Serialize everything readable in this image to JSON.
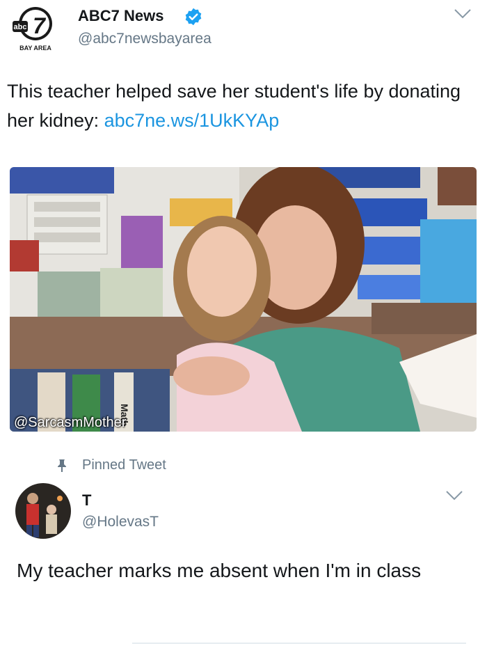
{
  "tweet1": {
    "display_name": "ABC7 News",
    "handle": "@abc7newsbayarea",
    "logo_text": "abc",
    "logo_number": "7",
    "logo_caption": "BAY AREA",
    "text": "This teacher helped save her student's life by donating her kidney: ",
    "link": "abc7ne.ws/1UkKYAp",
    "media_watermark": "@SarcasmMother",
    "media_book_label": "Math"
  },
  "pinned": {
    "label": "Pinned Tweet"
  },
  "tweet2": {
    "display_name": "T",
    "handle": "@HolevasT",
    "text": "My teacher marks me absent when I'm in class"
  },
  "colors": {
    "link": "#1b95e0",
    "secondary_text": "#657786",
    "verified": "#1da1f2"
  }
}
